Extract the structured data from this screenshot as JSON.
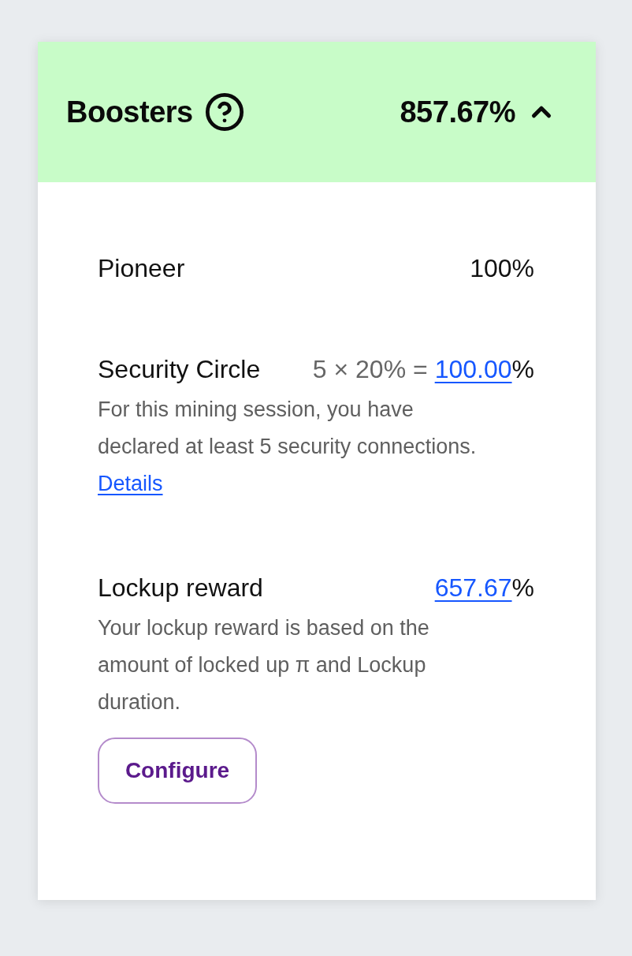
{
  "header": {
    "title": "Boosters",
    "total": "857.67%",
    "expanded": true
  },
  "boosters": [
    {
      "kind": "plain",
      "name": "Pioneer",
      "value": "100%"
    },
    {
      "kind": "formula",
      "name": "Security Circle",
      "formula": "5 × 20% =",
      "value_link": "100.00",
      "unit": "%",
      "description": "For this mining session, you have declared at least 5 security connections.",
      "link": "Details"
    },
    {
      "kind": "action",
      "name": "Lockup reward",
      "value_link": "657.67",
      "unit": "%",
      "description": "Your lockup reward is based on the amount of locked up π and Lockup duration.",
      "button": "Configure"
    }
  ]
}
